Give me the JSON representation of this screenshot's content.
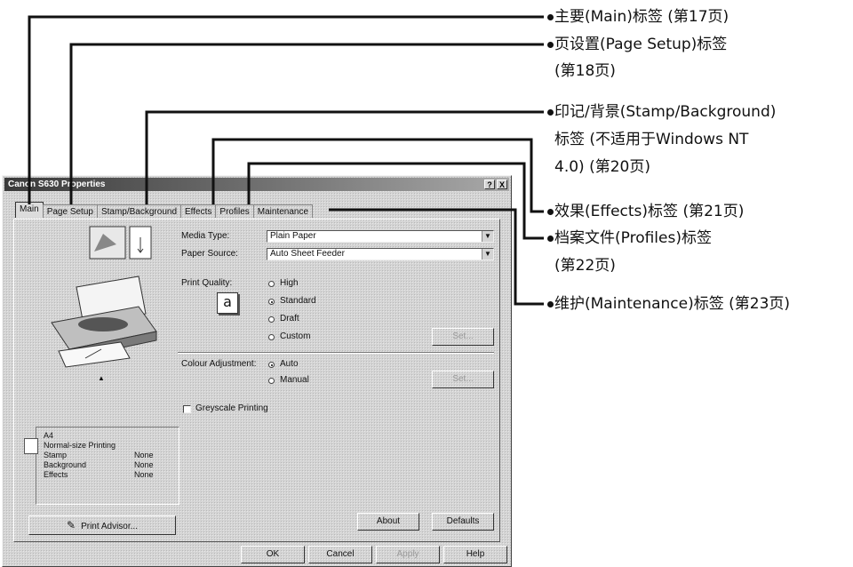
{
  "dialog": {
    "title": "Canon S630 Properties",
    "help_btn": "?",
    "close_btn": "X",
    "tabs": [
      {
        "label": "Main",
        "active": true
      },
      {
        "label": "Page Setup"
      },
      {
        "label": "Stamp/Background"
      },
      {
        "label": "Effects"
      },
      {
        "label": "Profiles"
      },
      {
        "label": "Maintenance"
      }
    ]
  },
  "main": {
    "media_type_label": "Media Type:",
    "media_type_value": "Plain Paper",
    "paper_source_label": "Paper Source:",
    "paper_source_value": "Auto Sheet Feeder",
    "print_quality_label": "Print Quality:",
    "quality_options": [
      "High",
      "Standard",
      "Draft",
      "Custom"
    ],
    "quality_selected": "Standard",
    "quality_icon": "a",
    "colour_adjustment_label": "Colour Adjustment:",
    "colour_options": [
      "Auto",
      "Manual"
    ],
    "colour_selected": "Auto",
    "greyscale_label": "Greyscale Printing",
    "greyscale_checked": false,
    "set_button_1": "Set...",
    "set_button_2": "Set...",
    "summary": {
      "paper_size": "A4",
      "print_type": "Normal-size Printing",
      "rows": [
        {
          "name": "Stamp",
          "value": "None"
        },
        {
          "name": "Background",
          "value": "None"
        },
        {
          "name": "Effects",
          "value": "None"
        }
      ]
    },
    "print_advisor_button": "Print Advisor...",
    "about_button": "About",
    "defaults_button": "Defaults"
  },
  "footer": {
    "ok": "OK",
    "cancel": "Cancel",
    "apply": "Apply",
    "help": "Help"
  },
  "callouts": [
    {
      "lines": [
        "主要(Main)标签 (第17页)"
      ]
    },
    {
      "lines": [
        "页设置(Page Setup)标签",
        "(第18页)"
      ]
    },
    {
      "lines": [
        "印记/背景(Stamp/Background)",
        "标签 (不适用于Windows NT",
        "4.0) (第20页)"
      ]
    },
    {
      "lines": [
        "效果(Effects)标签 (第21页)"
      ]
    },
    {
      "lines": [
        "档案文件(Profiles)标签",
        "(第22页)"
      ]
    },
    {
      "lines": [
        "维护(Maintenance)标签 (第23页)"
      ]
    }
  ],
  "colors": {
    "leader": "#111111",
    "dialog_bg": "#d4d4d4"
  }
}
